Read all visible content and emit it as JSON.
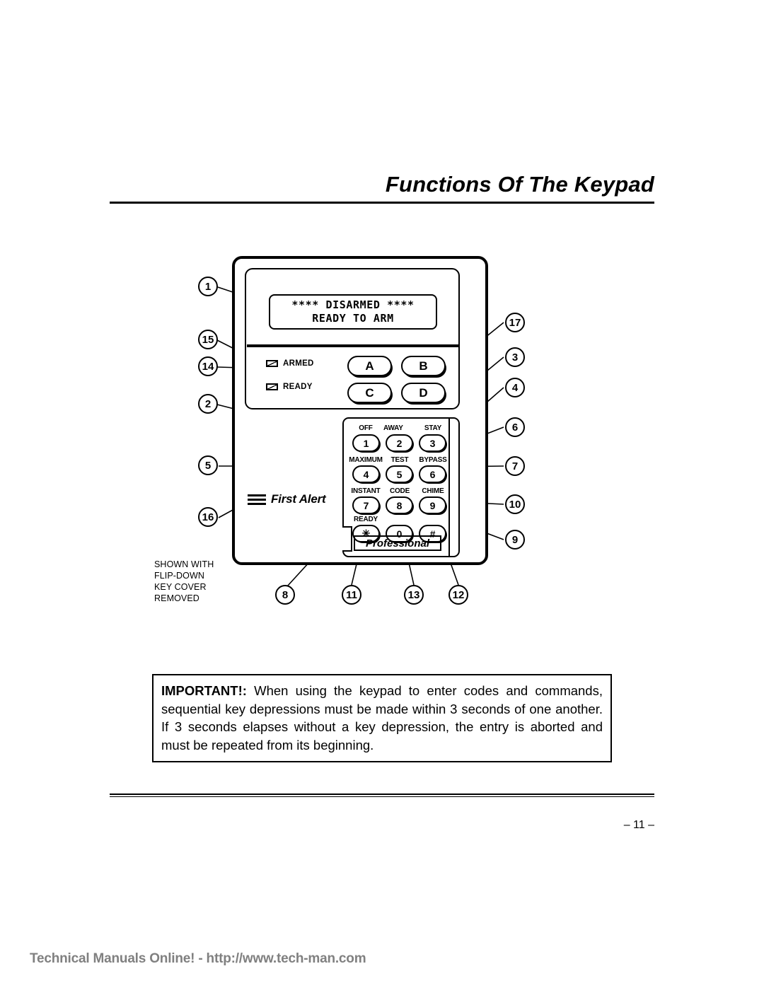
{
  "page": {
    "title": "Functions Of The Keypad",
    "page_number": "– 11 –",
    "site_banner": "Technical Manuals Online! - http://www.tech-man.com"
  },
  "keypad": {
    "lcd": {
      "line1": "**** DISARMED ****",
      "line2": "READY TO ARM"
    },
    "indicators": [
      {
        "id": "armed",
        "label": "ARMED",
        "icon": "led-icon"
      },
      {
        "id": "ready",
        "label": "READY",
        "icon": "led-icon"
      }
    ],
    "function_keys": [
      {
        "id": "a",
        "label": "A"
      },
      {
        "id": "b",
        "label": "B"
      },
      {
        "id": "c",
        "label": "C"
      },
      {
        "id": "d",
        "label": "D"
      }
    ],
    "number_keys": [
      {
        "digit": "1",
        "caption": "OFF"
      },
      {
        "digit": "2",
        "caption": "AWAY"
      },
      {
        "digit": "3",
        "caption": "STAY"
      },
      {
        "digit": "4",
        "caption": "MAXIMUM"
      },
      {
        "digit": "5",
        "caption": "TEST"
      },
      {
        "digit": "6",
        "caption": "BYPASS"
      },
      {
        "digit": "7",
        "caption": "INSTANT"
      },
      {
        "digit": "8",
        "caption": "CODE"
      },
      {
        "digit": "9",
        "caption": "CHIME"
      },
      {
        "digit": "✳",
        "caption": "READY"
      },
      {
        "digit": "0",
        "caption": ""
      },
      {
        "digit": "#",
        "caption": ""
      }
    ],
    "brand_name": "First Alert",
    "model_label": "Professional",
    "note": "SHOWN WITH\nFLIP-DOWN\nKEY COVER\nREMOVED"
  },
  "callouts": [
    {
      "n": "1"
    },
    {
      "n": "15"
    },
    {
      "n": "14"
    },
    {
      "n": "2"
    },
    {
      "n": "5"
    },
    {
      "n": "16"
    },
    {
      "n": "17"
    },
    {
      "n": "3"
    },
    {
      "n": "4"
    },
    {
      "n": "6"
    },
    {
      "n": "7"
    },
    {
      "n": "10"
    },
    {
      "n": "9"
    },
    {
      "n": "8"
    },
    {
      "n": "11"
    },
    {
      "n": "13"
    },
    {
      "n": "12"
    }
  ],
  "important": {
    "lead": "IMPORTANT!:",
    "body": " When using the keypad to enter codes and commands, sequential key depressions must be made within 3 seconds of one another. If 3 seconds elapses without a key depression, the entry is aborted and must be repeated from its beginning."
  },
  "colors": {
    "ink": "#000000",
    "paper": "#ffffff",
    "banner": "#808080"
  }
}
